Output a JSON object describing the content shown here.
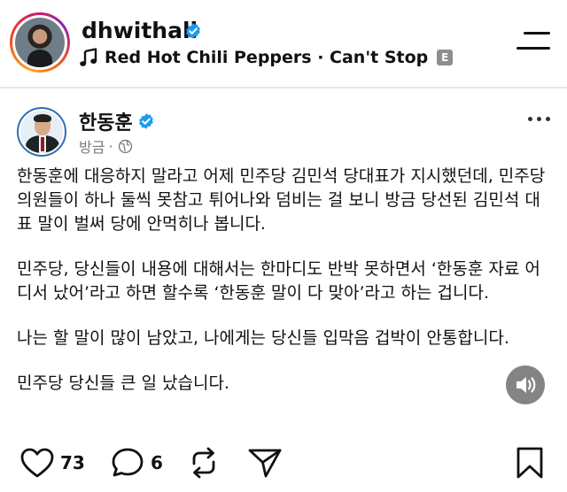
{
  "header": {
    "username": "dhwithall",
    "music": {
      "track": "Red Hot Chili Peppers · Can't Stop",
      "explicit_badge": "E"
    }
  },
  "post": {
    "author": "한동훈",
    "time": "방금",
    "separator": "·",
    "paragraphs": [
      "한동훈에 대응하지 말라고 어제 민주당 김민석 당대표가 지시했던데, 민주당 의원들이 하나 둘씩 못참고 튀어나와 덤비는 걸 보니 방금 당선된 김민석 대표 말이 벌써 당에 안먹히나 봅니다.",
      "민주당, 당신들이 내용에 대해서는 한마디도 반박 못하면서 ‘한동훈 자료 어디서 났어’라고 하면 할수록 ‘한동훈 말이 다 맞아’라고 하는 겁니다.",
      "나는 할 말이 많이 남았고, 나에게는 당신들 입막음 겁박이 안통합니다.",
      "민주당 당신들 큰 일 났습니다."
    ]
  },
  "actions": {
    "likes": "73",
    "comments": "6"
  },
  "icons": {
    "verified": "verified-badge-icon",
    "music": "music-note-icon",
    "menu": "menu-icon",
    "globe": "globe-icon",
    "more": "more-options-icon",
    "sound": "sound-icon",
    "like": "heart-icon",
    "comment": "comment-icon",
    "repost": "repost-icon",
    "share": "send-icon",
    "save": "bookmark-icon"
  },
  "colors": {
    "verified_blue": "#1d9bf0",
    "avatar_ring": "#2f6fb5",
    "text_primary": "#111111",
    "text_secondary": "#7a7a7a"
  }
}
